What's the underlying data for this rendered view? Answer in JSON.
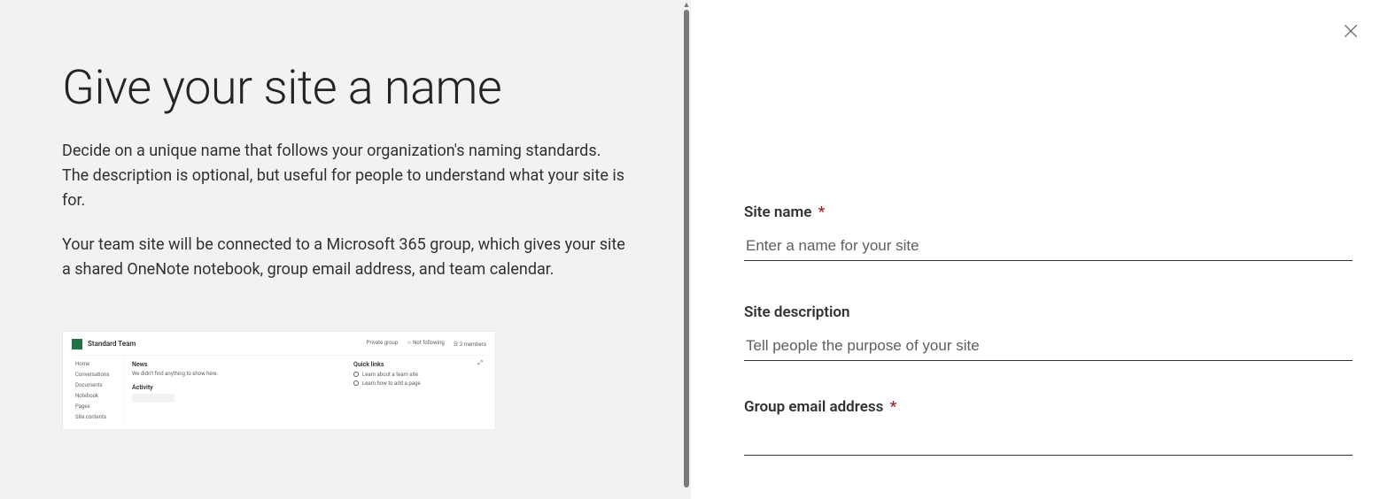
{
  "left": {
    "title": "Give your site a name",
    "paragraph1": "Decide on a unique name that follows your organization's naming standards. The description is optional, but useful for people to understand what your site is for.",
    "paragraph2": "Your team site will be connected to a Microsoft 365 group, which gives your site a shared OneNote notebook, group email address, and team calendar."
  },
  "preview": {
    "site_title": "Standard Team",
    "header_right": {
      "group": "Private group",
      "following": "☆ Not following",
      "members": "요 2 members"
    },
    "nav": [
      "Home",
      "Conversations",
      "Documents",
      "Notebook",
      "Pages",
      "Site contents"
    ],
    "news_title": "News",
    "news_sub": "We didn't find anything to show here.",
    "activity_title": "Activity",
    "quicklinks_title": "Quick links",
    "link1": "Learn about a team site",
    "link2": "Learn how to add a page"
  },
  "form": {
    "site_name": {
      "label": "Site name",
      "required": "*",
      "placeholder": "Enter a name for your site",
      "value": ""
    },
    "site_description": {
      "label": "Site description",
      "placeholder": "Tell people the purpose of your site",
      "value": ""
    },
    "group_email": {
      "label": "Group email address",
      "required": "*",
      "placeholder": "",
      "value": ""
    }
  }
}
